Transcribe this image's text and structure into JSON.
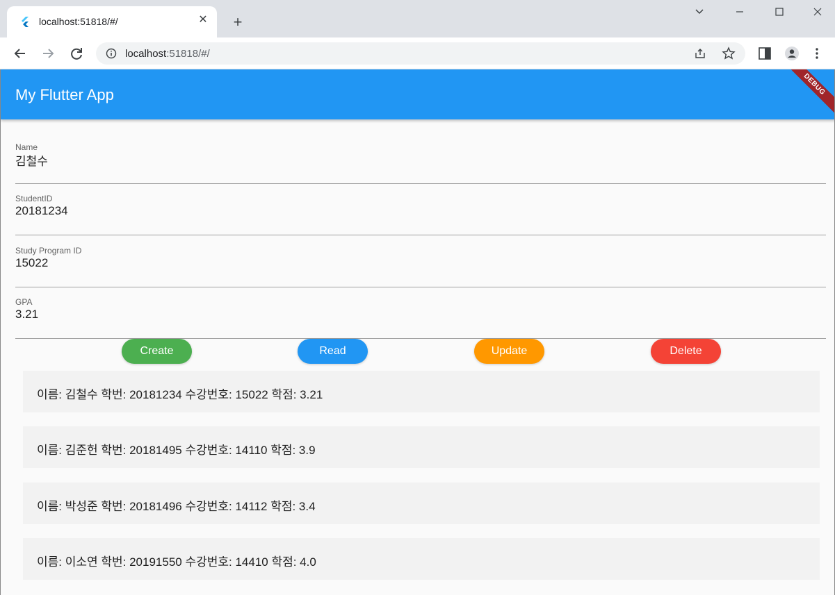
{
  "browser": {
    "tab_title": "localhost:51818/#/",
    "url_host": "localhost",
    "url_path": ":51818/#/",
    "new_tab_label": "+",
    "close_tab_label": "✕"
  },
  "app": {
    "title": "My Flutter App",
    "debug_banner": "DEBUG",
    "colors": {
      "appbar": "#2196f3",
      "create": "#4caf50",
      "read": "#2196f3",
      "update": "#ff9800",
      "delete": "#f44336"
    },
    "fields": {
      "name": {
        "label": "Name",
        "value": "김철수"
      },
      "student_id": {
        "label": "StudentID",
        "value": "20181234"
      },
      "study_program_id": {
        "label": "Study Program ID",
        "value": "15022"
      },
      "gpa": {
        "label": "GPA",
        "value": "3.21"
      }
    },
    "buttons": {
      "create": "Create",
      "read": "Read",
      "update": "Update",
      "delete": "Delete"
    },
    "records": [
      "이름: 김철수 학번: 20181234 수강번호: 15022 학점: 3.21",
      "이름: 김준헌 학번: 20181495 수강번호: 14110 학점: 3.9",
      "이름: 박성준 학번: 20181496 수강번호: 14112 학점: 3.4",
      "이름: 이소연 학번: 20191550 수강번호: 14410 학점: 4.0"
    ]
  }
}
